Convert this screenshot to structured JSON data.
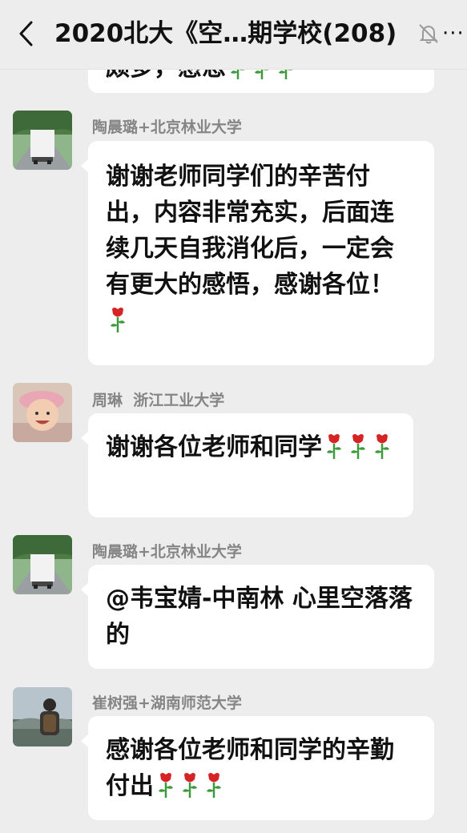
{
  "header": {
    "title": "2020北大《空…期学校(208)",
    "more_label": "···",
    "back_icon": "chevron-left-icon",
    "mute_icon": "bell-off-icon"
  },
  "colors": {
    "background": "#ededed",
    "bubble": "#ffffff",
    "text": "#111111",
    "name": "#858585",
    "rose_petal": "#d62424",
    "rose_stem": "#3c9a3c"
  },
  "messages": [
    {
      "sender": "",
      "text": "颇多，感恩",
      "emoji": "rose",
      "emoji_count": 3,
      "partial": true
    },
    {
      "sender": "陶晨璐+北京林业大学",
      "avatar": "truck-on-road-photo",
      "text": "谢谢老师同学们的辛苦付出，内容非常充实，后面连续几天自我消化后，一定会有更大的感悟，感谢各位！",
      "emoji": "rose",
      "emoji_count": 1
    },
    {
      "sender": "周琳  浙江工业大学",
      "avatar": "smiling-child-photo",
      "text": "谢谢各位老师和同学",
      "emoji": "rose",
      "emoji_count": 3
    },
    {
      "sender": "陶晨璐+北京林业大学",
      "avatar": "truck-on-road-photo",
      "text": "@韦宝婧-中南林 心里空落落的",
      "emoji_count": 0
    },
    {
      "sender": "崔树强+湖南师范大学",
      "avatar": "backpacker-photo",
      "text": "感谢各位老师和同学的辛勤付出",
      "emoji": "rose",
      "emoji_count": 3
    }
  ]
}
